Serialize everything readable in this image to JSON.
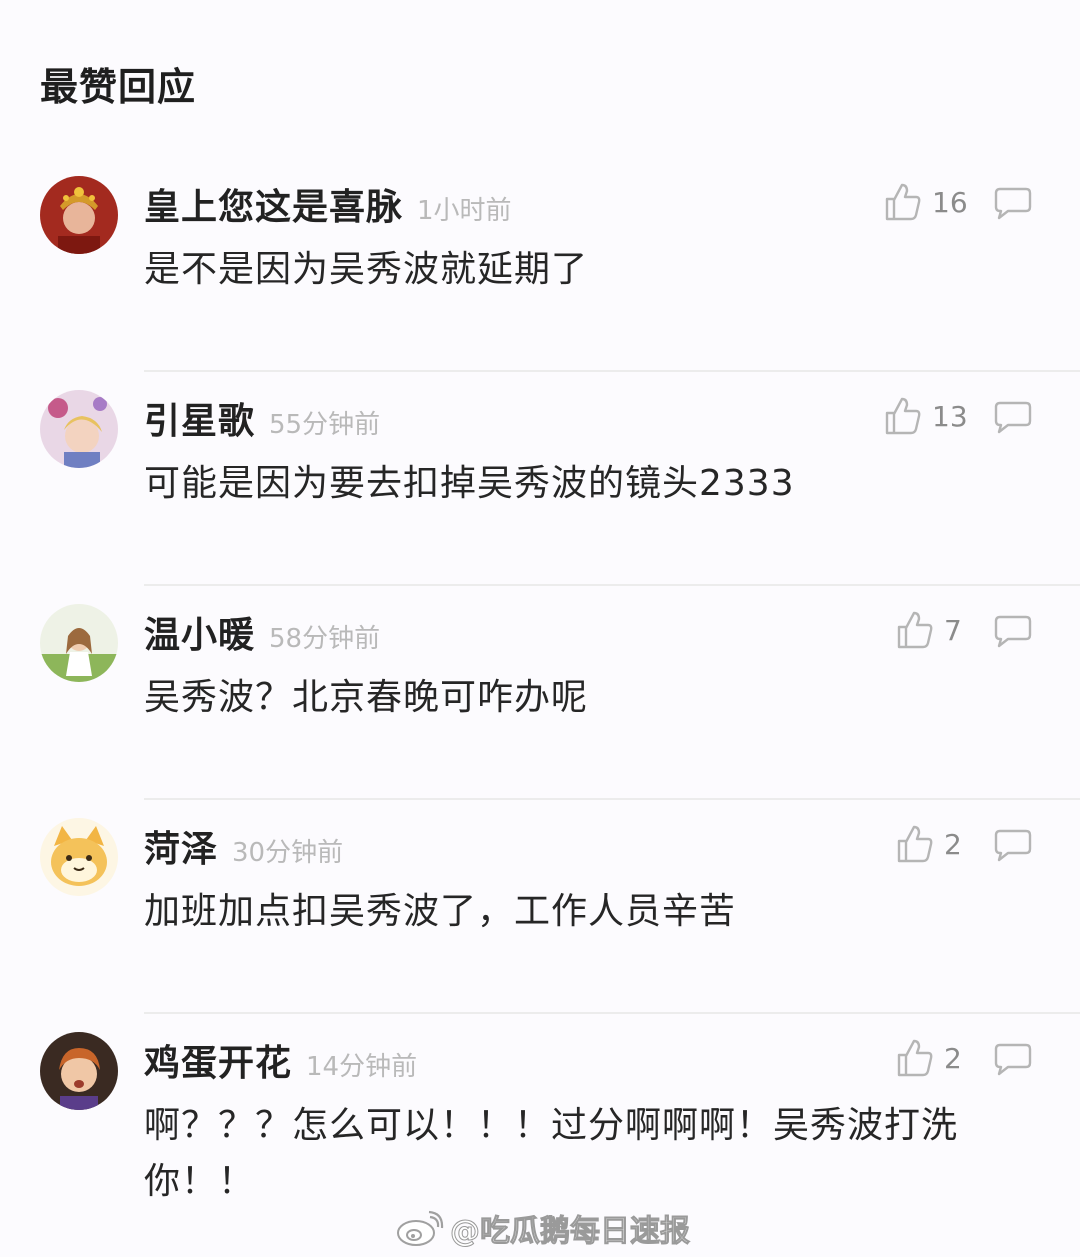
{
  "section": {
    "title": "最赞回应"
  },
  "icons": {
    "like": "thumbs-up-icon",
    "reply": "comment-bubble-icon"
  },
  "comments": [
    {
      "username": "皇上您这是喜脉",
      "time": "1小时前",
      "text": "是不是因为吴秀波就延期了",
      "likes": "16",
      "avatar": "avatar-red-costume"
    },
    {
      "username": "引星歌",
      "time": "55分钟前",
      "text": "可能是因为要去扣掉吴秀波的镜头2333",
      "likes": "13",
      "avatar": "avatar-anime-girl"
    },
    {
      "username": "温小暖",
      "time": "58分钟前",
      "text": "吴秀波？北京春晚可咋办呢",
      "likes": "7",
      "avatar": "avatar-girl-field"
    },
    {
      "username": "菏泽",
      "time": "30分钟前",
      "text": "加班加点扣吴秀波了，工作人员辛苦",
      "likes": "2",
      "avatar": "avatar-cartoon-cat"
    },
    {
      "username": "鸡蛋开花",
      "time": "14分钟前",
      "text": "啊？？？怎么可以！！！过分啊啊啊！吴秀波打洗你！！",
      "likes": "2",
      "avatar": "avatar-red-hair-boy"
    }
  ],
  "watermark": {
    "text": "@吃瓜鹅每日速报",
    "icon": "weibo-logo-icon"
  },
  "colors": {
    "background": "#fcfbfe",
    "muted": "#b9b9b9",
    "icon": "#b5b5b5"
  }
}
